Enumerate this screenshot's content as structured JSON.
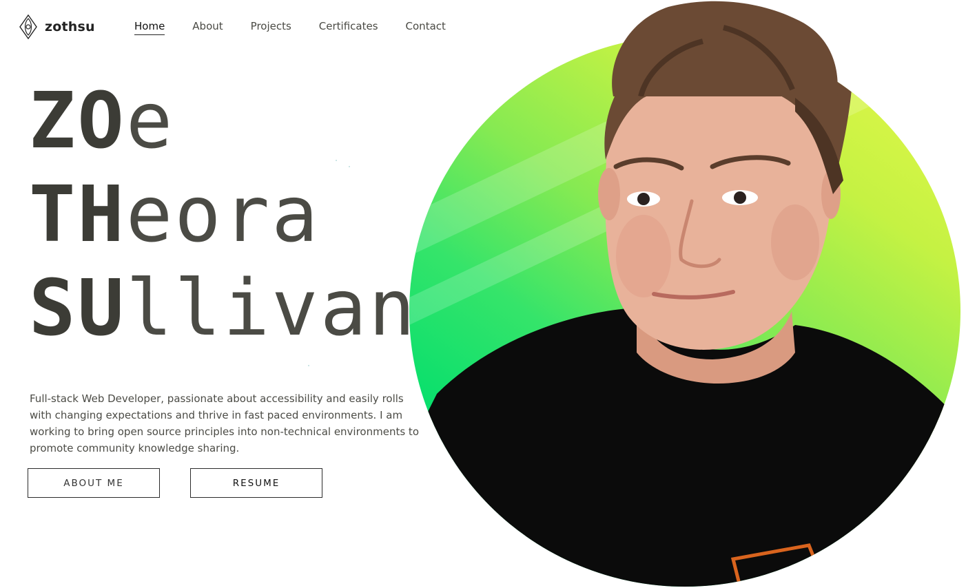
{
  "header": {
    "logo_text": "zothsu",
    "logo_icon": "diamond-swirl-logo",
    "nav": [
      {
        "label": "Home",
        "active": true
      },
      {
        "label": "About",
        "active": false
      },
      {
        "label": "Projects",
        "active": false
      },
      {
        "label": "Certificates",
        "active": false
      },
      {
        "label": "Contact",
        "active": false
      }
    ]
  },
  "hero": {
    "lines": [
      {
        "bold": "ZO",
        "light": "e"
      },
      {
        "bold": "TH",
        "light": "eora"
      },
      {
        "bold": "SU",
        "light": "llivan"
      }
    ],
    "bio": "Full-stack Web Developer, passionate about accessibility and easily rolls with changing expectations and thrive in fast paced environments. I am working to bring open source principles into non-technical environments to promote community knowledge sharing.",
    "buttons": {
      "about": "ABOUT ME",
      "resume": "RESUME"
    }
  },
  "portrait": {
    "gradient_colors": [
      "#e9f84a",
      "#86ea52",
      "#00dc6c"
    ],
    "shirt_color": "#0b0b0b"
  },
  "colors": {
    "text": "#3c3c36",
    "background": "#ffffff"
  }
}
